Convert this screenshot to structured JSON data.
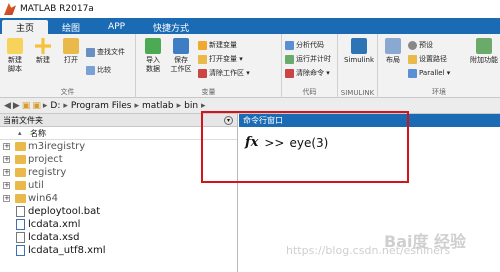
{
  "app": {
    "title": "MATLAB R2017a"
  },
  "tabs": [
    "主页",
    "绘图",
    "APP",
    "快捷方式"
  ],
  "ribbon": {
    "file_group": {
      "label": "文件",
      "new_script": "新建\n脚本",
      "new": "新建",
      "open": "打开",
      "find_files": "查找文件",
      "compare": "比较"
    },
    "var_group": {
      "label": "变量",
      "import": "导入\n数据",
      "save": "保存\n工作区",
      "new_var": "新建变量",
      "open_var": "打开变量 ▾",
      "clear_ws": "清除工作区 ▾"
    },
    "code_group": {
      "label": "代码",
      "analyze": "分析代码",
      "run_time": "运行并计时",
      "clear_cmd": "清除命令 ▾"
    },
    "simulink_group": {
      "label": "SIMULINK",
      "simulink": "Simulink"
    },
    "env_group": {
      "label": "环境",
      "layout": "布局",
      "prefs": "预设",
      "set_path": "设置路径",
      "parallel": "Parallel ▾",
      "addons": "附加功能"
    }
  },
  "address": {
    "drive": "D:",
    "path": [
      "Program Files",
      "matlab",
      "bin"
    ]
  },
  "file_browser": {
    "title": "当前文件夹",
    "column": "名称",
    "items": [
      {
        "name": "m3iregistry",
        "type": "folder"
      },
      {
        "name": "project",
        "type": "folder"
      },
      {
        "name": "registry",
        "type": "folder"
      },
      {
        "name": "util",
        "type": "folder"
      },
      {
        "name": "win64",
        "type": "folder"
      },
      {
        "name": "deploytool.bat",
        "type": "file"
      },
      {
        "name": "lcdata.xml",
        "type": "xml"
      },
      {
        "name": "lcdata.xsd",
        "type": "file"
      },
      {
        "name": "lcdata_utf8.xml",
        "type": "xml"
      }
    ]
  },
  "command_window": {
    "title": "命令行窗口",
    "prompt": ">>",
    "command": "eye(3)",
    "fx": "fx"
  },
  "watermark": {
    "url": "https://blog.csdn.net/eshiners",
    "brand": "Bai度 经验"
  }
}
